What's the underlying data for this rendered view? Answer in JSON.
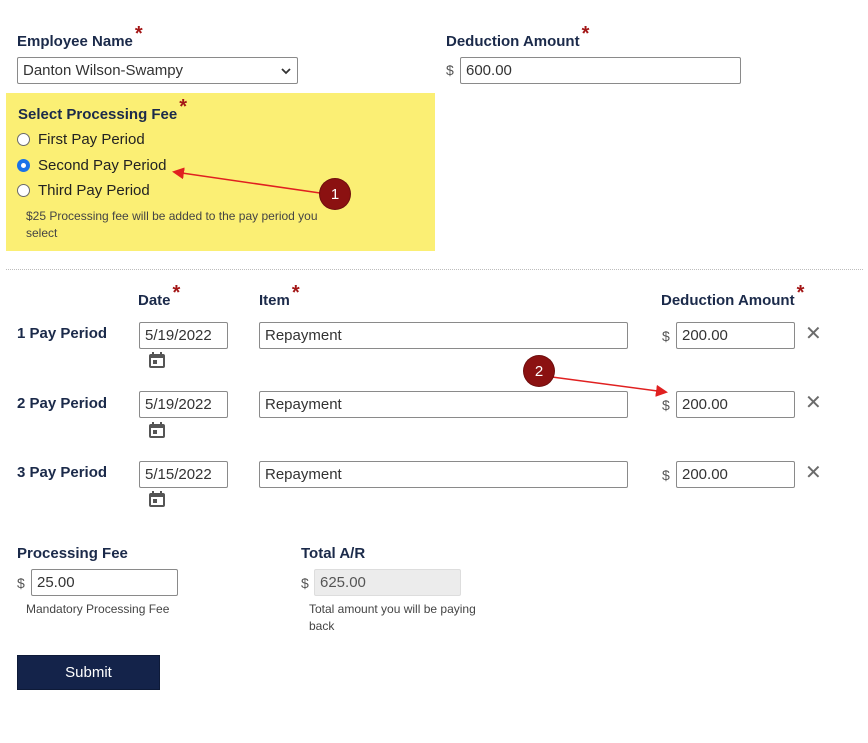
{
  "employee": {
    "label": "Employee Name",
    "required": "*",
    "selected": "Danton Wilson-Swampy"
  },
  "deduction_top": {
    "label": "Deduction Amount",
    "required": "*",
    "currency": "$",
    "value": "600.00"
  },
  "processing_select": {
    "label": "Select Processing Fee",
    "required": "*",
    "options": [
      {
        "label": "First Pay Period",
        "checked": false
      },
      {
        "label": "Second Pay Period",
        "checked": true
      },
      {
        "label": "Third Pay Period",
        "checked": false
      }
    ],
    "help": "$25 Processing fee will be added to the pay period you select",
    "highlight_color": "#fbef74"
  },
  "table": {
    "headers": {
      "date": "Date",
      "item": "Item",
      "deduction": "Deduction Amount",
      "required": "*"
    },
    "rows": [
      {
        "period": "1 Pay Period",
        "date": "5/19/2022",
        "item": "Repayment",
        "currency": "$",
        "amount": "200.00",
        "remove": "✕"
      },
      {
        "period": "2 Pay Period",
        "date": "5/19/2022",
        "item": "Repayment",
        "currency": "$",
        "amount": "200.00",
        "remove": "✕"
      },
      {
        "period": "3 Pay Period",
        "date": "5/15/2022",
        "item": "Repayment",
        "currency": "$",
        "amount": "200.00",
        "remove": "✕"
      }
    ]
  },
  "processing_fee": {
    "label": "Processing Fee",
    "currency": "$",
    "value": "25.00",
    "help": "Mandatory Processing Fee"
  },
  "total_ar": {
    "label": "Total A/R",
    "currency": "$",
    "value": "625.00",
    "help": "Total amount you will be paying back"
  },
  "submit": {
    "label": "Submit"
  },
  "annotations": [
    {
      "number": "1"
    },
    {
      "number": "2"
    }
  ],
  "colors": {
    "accent": "#14234a",
    "required": "#a31616",
    "annotation": "#8b1111",
    "arrow": "#e02020"
  }
}
